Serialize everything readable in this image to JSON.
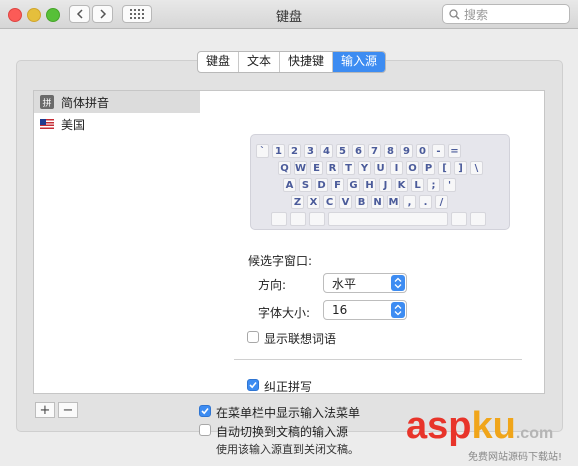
{
  "window": {
    "title": "键盘"
  },
  "search": {
    "placeholder": "搜索"
  },
  "tabs": [
    {
      "label": "键盘"
    },
    {
      "label": "文本"
    },
    {
      "label": "快捷键"
    },
    {
      "label": "输入源"
    }
  ],
  "sources": [
    {
      "label": "简体拼音",
      "icon": "拼"
    },
    {
      "label": "美国"
    }
  ],
  "keyboard": {
    "row1": [
      "`",
      "1",
      "2",
      "3",
      "4",
      "5",
      "6",
      "7",
      "8",
      "9",
      "0",
      "-",
      "="
    ],
    "row2": [
      "Q",
      "W",
      "E",
      "R",
      "T",
      "Y",
      "U",
      "I",
      "O",
      "P",
      "[",
      "]",
      "\\"
    ],
    "row3": [
      "A",
      "S",
      "D",
      "F",
      "G",
      "H",
      "J",
      "K",
      "L",
      ";",
      "'"
    ],
    "row4": [
      "Z",
      "X",
      "C",
      "V",
      "B",
      "N",
      "M",
      ",",
      ".",
      "/"
    ]
  },
  "candidate": {
    "heading": "候选字窗口:",
    "direction_label": "方向:",
    "direction_value": "水平",
    "fontsize_label": "字体大小:",
    "fontsize_value": "16",
    "show_assoc": "显示联想词语",
    "show_assoc_checked": false
  },
  "autocorrect": {
    "label": "纠正拼写",
    "checked": true
  },
  "bottom": {
    "add": "+",
    "remove": "−",
    "show_menu": "在菜单栏中显示输入法菜单",
    "show_menu_checked": true,
    "auto_switch": "自动切换到文稿的输入源",
    "auto_switch_checked": false,
    "note": "使用该输入源直到关闭文稿。"
  },
  "watermark": {
    "brand_asp": "asp",
    "brand_ku": "ku",
    "brand_com": ".com",
    "slogan": "免费网站源码下载站!"
  }
}
